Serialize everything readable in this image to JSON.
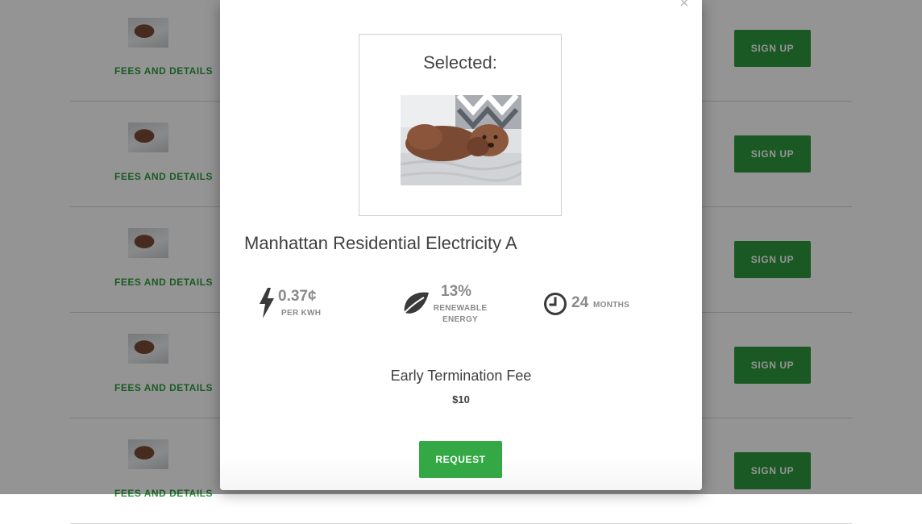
{
  "list": {
    "rows": [
      {
        "fees_label": "FEES AND DETAILS",
        "signup_label": "SIGN UP"
      },
      {
        "fees_label": "FEES AND DETAILS",
        "signup_label": "SIGN UP"
      },
      {
        "fees_label": "FEES AND DETAILS",
        "signup_label": "SIGN UP"
      },
      {
        "fees_label": "FEES AND DETAILS",
        "signup_label": "SIGN UP"
      },
      {
        "fees_label": "FEES AND DETAILS",
        "signup_label": "SIGN UP"
      }
    ]
  },
  "modal": {
    "close_glyph": "×",
    "selected_heading": "Selected:",
    "plan_name": "Manhattan Residential Electricity A",
    "stats": {
      "rate_value": "0.37¢",
      "rate_unit": "PER KWH",
      "renewable_value": "13%",
      "renewable_unit_line1": "RENEWABLE",
      "renewable_unit_line2": "ENERGY",
      "term_value": "24",
      "term_unit": "MONTHS"
    },
    "etf_label": "Early Termination Fee",
    "etf_value": "$10",
    "request_label": "REQUEST"
  },
  "icons": {
    "rate": "lightning-bolt-icon",
    "renewable": "leaf-icon",
    "term": "clock-icon"
  },
  "colors": {
    "accent_green": "#2f9a3e",
    "request_green": "#33a845",
    "link_green": "#2e9e3e"
  }
}
